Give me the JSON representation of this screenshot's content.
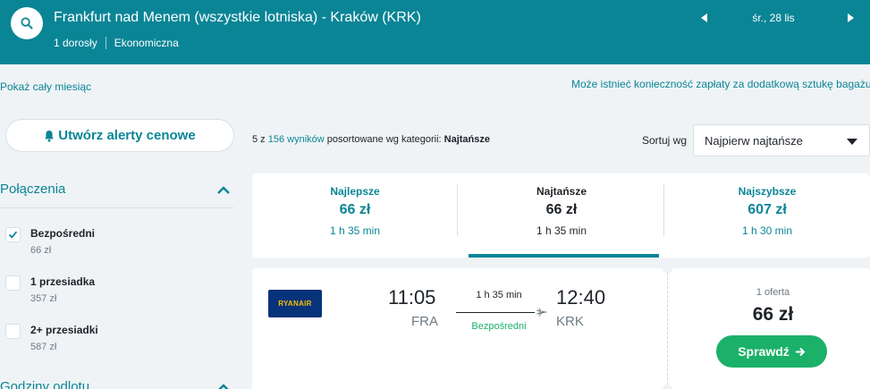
{
  "header": {
    "route_title": "Frankfurt nad Menem (wszystkie lotniska) - Kraków (KRK)",
    "passengers": "1 dorosły",
    "cabin_class": "Ekonomiczna",
    "date": "śr., 28 lis"
  },
  "links": {
    "whole_month": "Pokaż cały miesiąc",
    "baggage_notice": "Może istnieć konieczność zapłaty za dodatkową sztukę bagażu"
  },
  "sidebar": {
    "alert_button": "Utwórz alerty cenowe",
    "connections_title": "Połączenia",
    "filters": [
      {
        "label": "Bezpośredni",
        "price": "66 zł",
        "checked": true
      },
      {
        "label": "1 przesiadka",
        "price": "357 zł",
        "checked": false
      },
      {
        "label": "2+ przesiadki",
        "price": "587 zł",
        "checked": false
      }
    ],
    "departure_times_title": "Godziny odlotu"
  },
  "results": {
    "prefix": "5 z",
    "count_link": "156 wyników",
    "sorted_text": "posortowane wg kategorii:",
    "category": "Najtańsze",
    "sort_label": "Sortuj wg",
    "sort_value": "Najpierw najtańsze"
  },
  "tabs": [
    {
      "name": "Najlepsze",
      "price": "66 zł",
      "duration": "1 h 35 min"
    },
    {
      "name": "Najtańsze",
      "price": "66 zł",
      "duration": "1 h 35 min",
      "active": true
    },
    {
      "name": "Najszybsze",
      "price": "607 zł",
      "duration": "1 h 30 min"
    }
  ],
  "flight": {
    "airline": "RYANAIR",
    "departure_time": "11:05",
    "departure_code": "FRA",
    "arrival_time": "12:40",
    "arrival_code": "KRK",
    "duration": "1 h 35 min",
    "stops": "Bezpośredni",
    "offers": "1 oferta",
    "price": "66 zł",
    "button": "Sprawdź"
  },
  "colors": {
    "brand_teal": "#0a8596",
    "success_green": "#1bb169",
    "background": "#eff3f6",
    "airline_navy": "#07337a"
  }
}
